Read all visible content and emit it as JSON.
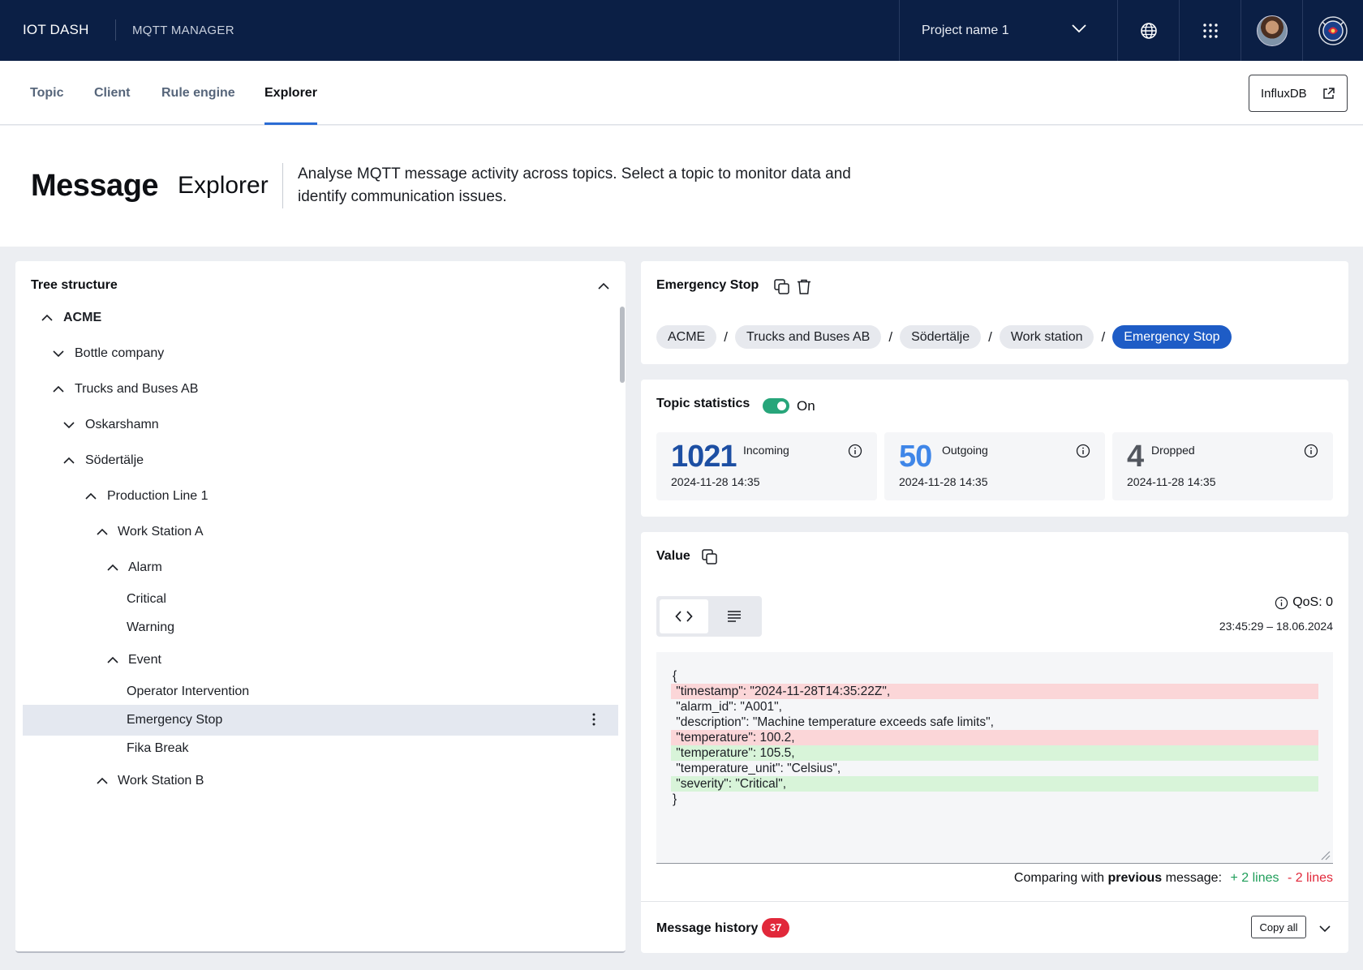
{
  "topbar": {
    "brand": "IOT DASH",
    "subbrand": "MQTT MANAGER",
    "project": "Project name 1",
    "icons": [
      "chevron-down-icon",
      "globe-icon",
      "apps-grid-icon",
      "avatar",
      "logo-icon"
    ]
  },
  "tabs": [
    {
      "label": "Topic"
    },
    {
      "label": "Client"
    },
    {
      "label": "Rule engine"
    },
    {
      "label": "Explorer",
      "active": true
    }
  ],
  "influx_label": "InfluxDB",
  "header": {
    "title": "Message",
    "subtitle": "Explorer",
    "description": "Analyse MQTT message activity across topics. Select a topic to monitor data and identify communication issues."
  },
  "tree": {
    "title": "Tree structure",
    "items": [
      {
        "label": "ACME",
        "chevron": "up",
        "bold": true
      },
      {
        "label": "Bottle company",
        "chevron": "down"
      },
      {
        "label": "Trucks and Buses AB",
        "chevron": "up"
      },
      {
        "label": "Oskarshamn",
        "chevron": "down"
      },
      {
        "label": "Södertälje",
        "chevron": "up"
      },
      {
        "label": "Production Line 1",
        "chevron": "up"
      },
      {
        "label": "Work Station A",
        "chevron": "up"
      },
      {
        "label": "Alarm",
        "chevron": "up"
      },
      {
        "label": "Critical",
        "chevron": "none"
      },
      {
        "label": "Warning",
        "chevron": "none"
      },
      {
        "label": "Event",
        "chevron": "up"
      },
      {
        "label": "Operator Intervention",
        "chevron": "none"
      },
      {
        "label": "Emergency Stop",
        "chevron": "none",
        "selected": true
      },
      {
        "label": "Fika Break",
        "chevron": "none"
      },
      {
        "label": "Work Station B",
        "chevron": "up"
      }
    ]
  },
  "topic": {
    "title": "Emergency Stop",
    "breadcrumb": [
      "ACME",
      "Trucks and Buses AB",
      "Södertälje",
      "Work station",
      "Emergency Stop"
    ]
  },
  "stats": {
    "title": "Topic statistics",
    "toggle_label": "On",
    "items": [
      {
        "value": "1021",
        "label": "Incoming",
        "date": "2024-11-28 14:35",
        "color": "#1d4fa3"
      },
      {
        "value": "50",
        "label": "Outgoing",
        "date": "2024-11-28 14:35",
        "color": "#3f86e8"
      },
      {
        "value": "4",
        "label": "Dropped",
        "date": "2024-11-28 14:35",
        "color": "#53575f"
      }
    ]
  },
  "value": {
    "title": "Value",
    "qos": "QoS: 0",
    "timestamp": "23:45:29 – 18.06.2024",
    "lines": [
      {
        "text": "{",
        "state": "normal"
      },
      {
        "text": " \"timestamp\": \"2024-11-28T14:35:22Z\",",
        "state": "removed"
      },
      {
        "text": " \"alarm_id\": \"A001\",",
        "state": "normal"
      },
      {
        "text": " \"description\": \"Machine temperature exceeds safe limits\",",
        "state": "normal"
      },
      {
        "text": " \"temperature\": 100.2,",
        "state": "removed"
      },
      {
        "text": " \"temperature\": 105.5,",
        "state": "added"
      },
      {
        "text": " \"temperature_unit\": \"Celsius\",",
        "state": "normal"
      },
      {
        "text": " \"severity\": \"Critical\",",
        "state": "added"
      },
      {
        "text": "}",
        "state": "normal"
      }
    ],
    "compare_prefix": "Comparing with ",
    "compare_bold": "previous",
    "compare_suffix": " message:",
    "added": "+ 2 lines",
    "removed": "- 2 lines"
  },
  "history": {
    "title": "Message history",
    "count": "37",
    "copy_label": "Copy all"
  }
}
